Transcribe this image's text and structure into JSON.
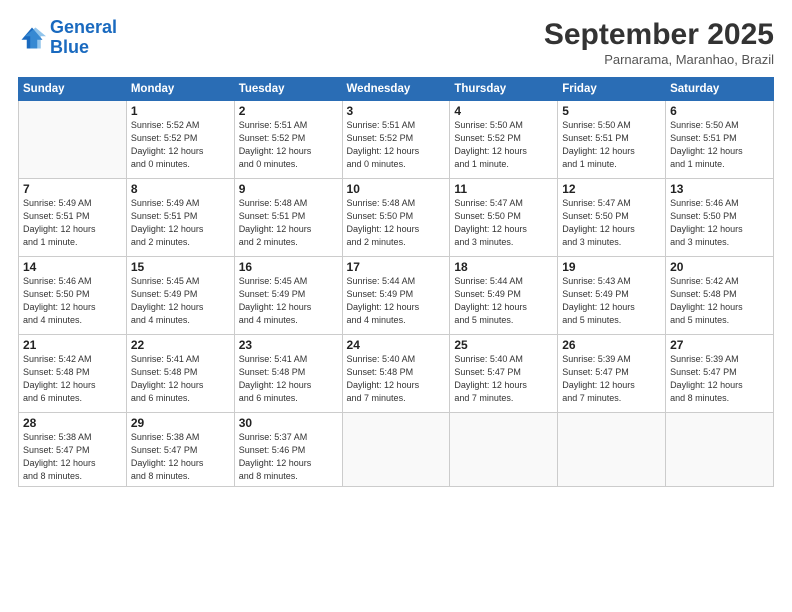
{
  "logo": {
    "line1": "General",
    "line2": "Blue"
  },
  "title": "September 2025",
  "subtitle": "Parnarama, Maranhao, Brazil",
  "weekdays": [
    "Sunday",
    "Monday",
    "Tuesday",
    "Wednesday",
    "Thursday",
    "Friday",
    "Saturday"
  ],
  "weeks": [
    [
      {
        "day": "",
        "info": ""
      },
      {
        "day": "1",
        "info": "Sunrise: 5:52 AM\nSunset: 5:52 PM\nDaylight: 12 hours\nand 0 minutes."
      },
      {
        "day": "2",
        "info": "Sunrise: 5:51 AM\nSunset: 5:52 PM\nDaylight: 12 hours\nand 0 minutes."
      },
      {
        "day": "3",
        "info": "Sunrise: 5:51 AM\nSunset: 5:52 PM\nDaylight: 12 hours\nand 0 minutes."
      },
      {
        "day": "4",
        "info": "Sunrise: 5:50 AM\nSunset: 5:52 PM\nDaylight: 12 hours\nand 1 minute."
      },
      {
        "day": "5",
        "info": "Sunrise: 5:50 AM\nSunset: 5:51 PM\nDaylight: 12 hours\nand 1 minute."
      },
      {
        "day": "6",
        "info": "Sunrise: 5:50 AM\nSunset: 5:51 PM\nDaylight: 12 hours\nand 1 minute."
      }
    ],
    [
      {
        "day": "7",
        "info": "Sunrise: 5:49 AM\nSunset: 5:51 PM\nDaylight: 12 hours\nand 1 minute."
      },
      {
        "day": "8",
        "info": "Sunrise: 5:49 AM\nSunset: 5:51 PM\nDaylight: 12 hours\nand 2 minutes."
      },
      {
        "day": "9",
        "info": "Sunrise: 5:48 AM\nSunset: 5:51 PM\nDaylight: 12 hours\nand 2 minutes."
      },
      {
        "day": "10",
        "info": "Sunrise: 5:48 AM\nSunset: 5:50 PM\nDaylight: 12 hours\nand 2 minutes."
      },
      {
        "day": "11",
        "info": "Sunrise: 5:47 AM\nSunset: 5:50 PM\nDaylight: 12 hours\nand 3 minutes."
      },
      {
        "day": "12",
        "info": "Sunrise: 5:47 AM\nSunset: 5:50 PM\nDaylight: 12 hours\nand 3 minutes."
      },
      {
        "day": "13",
        "info": "Sunrise: 5:46 AM\nSunset: 5:50 PM\nDaylight: 12 hours\nand 3 minutes."
      }
    ],
    [
      {
        "day": "14",
        "info": "Sunrise: 5:46 AM\nSunset: 5:50 PM\nDaylight: 12 hours\nand 4 minutes."
      },
      {
        "day": "15",
        "info": "Sunrise: 5:45 AM\nSunset: 5:49 PM\nDaylight: 12 hours\nand 4 minutes."
      },
      {
        "day": "16",
        "info": "Sunrise: 5:45 AM\nSunset: 5:49 PM\nDaylight: 12 hours\nand 4 minutes."
      },
      {
        "day": "17",
        "info": "Sunrise: 5:44 AM\nSunset: 5:49 PM\nDaylight: 12 hours\nand 4 minutes."
      },
      {
        "day": "18",
        "info": "Sunrise: 5:44 AM\nSunset: 5:49 PM\nDaylight: 12 hours\nand 5 minutes."
      },
      {
        "day": "19",
        "info": "Sunrise: 5:43 AM\nSunset: 5:49 PM\nDaylight: 12 hours\nand 5 minutes."
      },
      {
        "day": "20",
        "info": "Sunrise: 5:42 AM\nSunset: 5:48 PM\nDaylight: 12 hours\nand 5 minutes."
      }
    ],
    [
      {
        "day": "21",
        "info": "Sunrise: 5:42 AM\nSunset: 5:48 PM\nDaylight: 12 hours\nand 6 minutes."
      },
      {
        "day": "22",
        "info": "Sunrise: 5:41 AM\nSunset: 5:48 PM\nDaylight: 12 hours\nand 6 minutes."
      },
      {
        "day": "23",
        "info": "Sunrise: 5:41 AM\nSunset: 5:48 PM\nDaylight: 12 hours\nand 6 minutes."
      },
      {
        "day": "24",
        "info": "Sunrise: 5:40 AM\nSunset: 5:48 PM\nDaylight: 12 hours\nand 7 minutes."
      },
      {
        "day": "25",
        "info": "Sunrise: 5:40 AM\nSunset: 5:47 PM\nDaylight: 12 hours\nand 7 minutes."
      },
      {
        "day": "26",
        "info": "Sunrise: 5:39 AM\nSunset: 5:47 PM\nDaylight: 12 hours\nand 7 minutes."
      },
      {
        "day": "27",
        "info": "Sunrise: 5:39 AM\nSunset: 5:47 PM\nDaylight: 12 hours\nand 8 minutes."
      }
    ],
    [
      {
        "day": "28",
        "info": "Sunrise: 5:38 AM\nSunset: 5:47 PM\nDaylight: 12 hours\nand 8 minutes."
      },
      {
        "day": "29",
        "info": "Sunrise: 5:38 AM\nSunset: 5:47 PM\nDaylight: 12 hours\nand 8 minutes."
      },
      {
        "day": "30",
        "info": "Sunrise: 5:37 AM\nSunset: 5:46 PM\nDaylight: 12 hours\nand 8 minutes."
      },
      {
        "day": "",
        "info": ""
      },
      {
        "day": "",
        "info": ""
      },
      {
        "day": "",
        "info": ""
      },
      {
        "day": "",
        "info": ""
      }
    ]
  ]
}
